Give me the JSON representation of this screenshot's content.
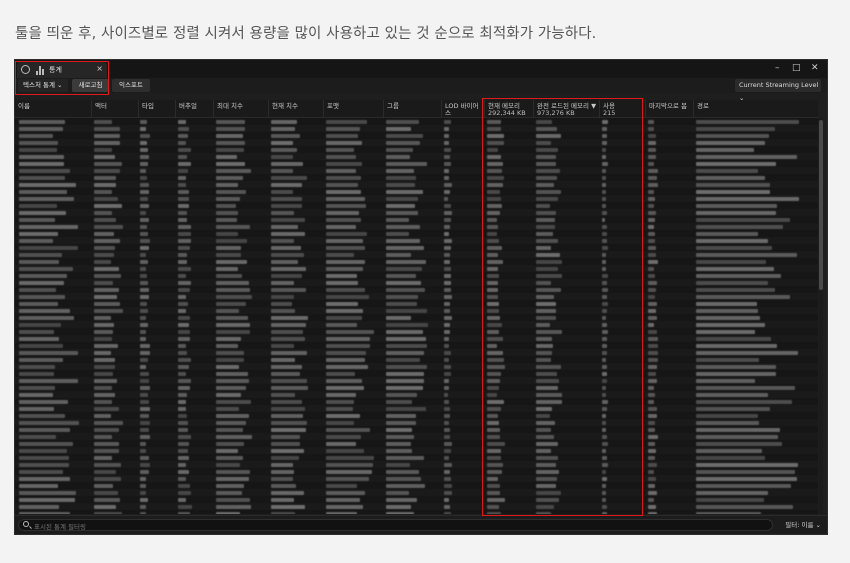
{
  "caption": "툴을 띄운 후, 사이즈별로 정렬 시켜서 용량을 많이 사용하고 있는 것 순으로 최적화가 가능하다.",
  "window": {
    "tab_title": "통계",
    "tab_close": "×",
    "controls": {
      "minimize": "–",
      "maximize": "□",
      "close": "✕"
    }
  },
  "toolbar": {
    "dropdown_label": "텍스처 통계 ⌄",
    "refresh_label": "새로고침",
    "export_label": "익스포트",
    "streaming_level_label": "Current Streaming Level ⌄"
  },
  "columns": [
    {
      "key": "name",
      "label": "이름"
    },
    {
      "key": "actor",
      "label": "액터"
    },
    {
      "key": "type",
      "label": "타입"
    },
    {
      "key": "blocks",
      "label": "버추얼"
    },
    {
      "key": "max_dim",
      "label": "최대 치수"
    },
    {
      "key": "cur_dim",
      "label": "현재 치수"
    },
    {
      "key": "format",
      "label": "포맷"
    },
    {
      "key": "group",
      "label": "그룹"
    },
    {
      "key": "lod_bias",
      "label": "LOD 바이어스"
    },
    {
      "key": "current_memory",
      "label": "현재 메모리",
      "sub": "292,344 KB"
    },
    {
      "key": "fully_loaded_memory",
      "label": "완전 로드된 메모리",
      "sub": "973,276 KB",
      "sorted": "▼"
    },
    {
      "key": "uses",
      "label": "사용",
      "sub": "215"
    },
    {
      "key": "last_seen",
      "label": "마지막으로 봄"
    },
    {
      "key": "path",
      "label": "경로"
    }
  ],
  "footer": {
    "search_placeholder": "표시된 통계 필터링",
    "filter_label": "필터: 이름 ⌄"
  },
  "colors": {
    "highlight": "#e0191b",
    "window_bg": "#1e1e1e"
  }
}
